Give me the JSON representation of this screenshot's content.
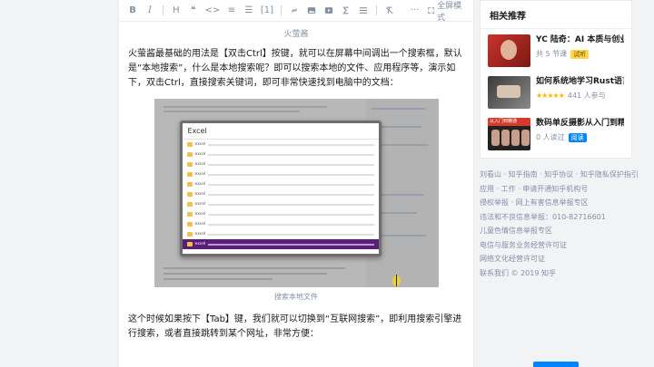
{
  "toolbar": {
    "bold": "B",
    "italic": "I",
    "heading": "H",
    "quote": "❝",
    "code": "<>",
    "ordered_list": "≡",
    "unordered_list": "☰",
    "reference": "[1]",
    "more": "···",
    "fullscreen_label": "全屏模式"
  },
  "article": {
    "caption_top": "火萤酱",
    "paragraph1": "火萤酱最基础的用法是【双击Ctrl】按键，就可以在屏幕中间调出一个搜索框，默认是“本地搜索”，什么是本地搜索呢？即可以搜索本地的文件、应用程序等，演示如下，双击Ctrl，直接搜索关键词，即可非常快速找到电脑中的文档：",
    "figure": {
      "panel_title": "Excel",
      "results": [
        "excel",
        "excel",
        "excel",
        "excel",
        "excel",
        "excel",
        "excel",
        "excel",
        "excel",
        "excel",
        "excel"
      ],
      "selected_index": 10
    },
    "caption_bottom": "搜索本地文件",
    "paragraph2": "这个时候如果按下【Tab】键，我们就可以切换到“互联网搜索”，即利用搜索引擎进行搜索，或者直接跳转到某个网址，非常方便："
  },
  "sidebar": {
    "title": "相关推荐",
    "items": [
      {
        "title": "YC 陆奇：AI 本质与创业创",
        "meta": "共 5 节课",
        "badge": "试听",
        "badge_style": "yellow"
      },
      {
        "title": "如何系统地学习Rust语言?",
        "stars": "★★★★★",
        "meta": "441 人参与"
      },
      {
        "title": "数码单反摄影从入门到精通",
        "meta": "0 人读过",
        "badge": "阅读",
        "badge_style": "blue",
        "thumb_label": "从入门到精通"
      }
    ]
  },
  "footer": {
    "lines": [
      "刘看山 · 知乎指南 · 知乎协议 · 知乎隐私保护指引",
      "应用 · 工作 · 申请开通知乎机构号",
      "侵权举报 · 网上有害信息举报专区",
      "违法和不良信息举报：010-82716601",
      "儿童色情信息举报专区",
      "电信与服务业务经营许可证",
      "网络文化经营许可证",
      "联系我们 © 2019 知乎"
    ]
  },
  "colors": {
    "accent": "#0084ff",
    "selected_result": "#5a1d7a",
    "muted_text": "#8590a6"
  }
}
